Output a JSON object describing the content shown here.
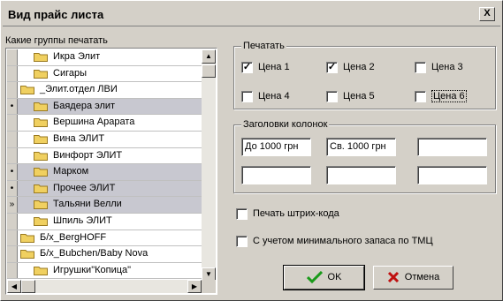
{
  "window": {
    "title": "Вид прайс листа",
    "close_glyph": "X"
  },
  "groups": {
    "label": "Какие группы печатать",
    "rows": [
      {
        "text": "Икра Элит",
        "marker": "",
        "selected": false,
        "indent": 1
      },
      {
        "text": "Сигары",
        "marker": "",
        "selected": false,
        "indent": 1
      },
      {
        "text": "_Элит.отдел ЛВИ",
        "marker": "",
        "selected": false,
        "indent": 0
      },
      {
        "text": "Баядера элит",
        "marker": "•",
        "selected": true,
        "indent": 1
      },
      {
        "text": "Вершина Арарата",
        "marker": "",
        "selected": false,
        "indent": 1
      },
      {
        "text": "Вина ЭЛИТ",
        "marker": "",
        "selected": false,
        "indent": 1
      },
      {
        "text": "Винфорт ЭЛИТ",
        "marker": "",
        "selected": false,
        "indent": 1
      },
      {
        "text": "Марком",
        "marker": "•",
        "selected": true,
        "indent": 1
      },
      {
        "text": "Прочее ЭЛИТ",
        "marker": "•",
        "selected": true,
        "indent": 1
      },
      {
        "text": "Тальяни Велли",
        "marker": "»",
        "selected": true,
        "indent": 1
      },
      {
        "text": "Шпиль ЭЛИТ",
        "marker": "",
        "selected": false,
        "indent": 1
      },
      {
        "text": "Б/х_BergHOFF",
        "marker": "",
        "selected": false,
        "indent": 0
      },
      {
        "text": "Б/х_Bubchen/Baby Nova",
        "marker": "",
        "selected": false,
        "indent": 0
      },
      {
        "text": "Игрушки\"Копица\"",
        "marker": "",
        "selected": false,
        "indent": 1
      }
    ]
  },
  "print": {
    "legend": "Печатать",
    "prices": [
      {
        "label": "Цена 1",
        "checked": true
      },
      {
        "label": "Цена 2",
        "checked": true
      },
      {
        "label": "Цена 3",
        "checked": false
      },
      {
        "label": "Цена 4",
        "checked": false
      },
      {
        "label": "Цена 5",
        "checked": false
      },
      {
        "label": "Цена 6",
        "checked": false
      }
    ]
  },
  "headers": {
    "legend": "Заголовки колонок",
    "fields": [
      "До 1000 грн",
      "Св. 1000 грн",
      "",
      "",
      "",
      ""
    ]
  },
  "options": {
    "barcode_label": "Печать штрих-кода",
    "min_stock_label": "С учетом минимального запаса по ТМЦ"
  },
  "buttons": {
    "ok": "OK",
    "cancel": "Отмена"
  },
  "colors": {
    "folder": "#f0d060",
    "ok_check": "#1a9a1a",
    "cancel_x": "#c01010"
  },
  "icons": {
    "row": "folder-icon",
    "ok": "check-icon",
    "cancel": "x-icon"
  }
}
